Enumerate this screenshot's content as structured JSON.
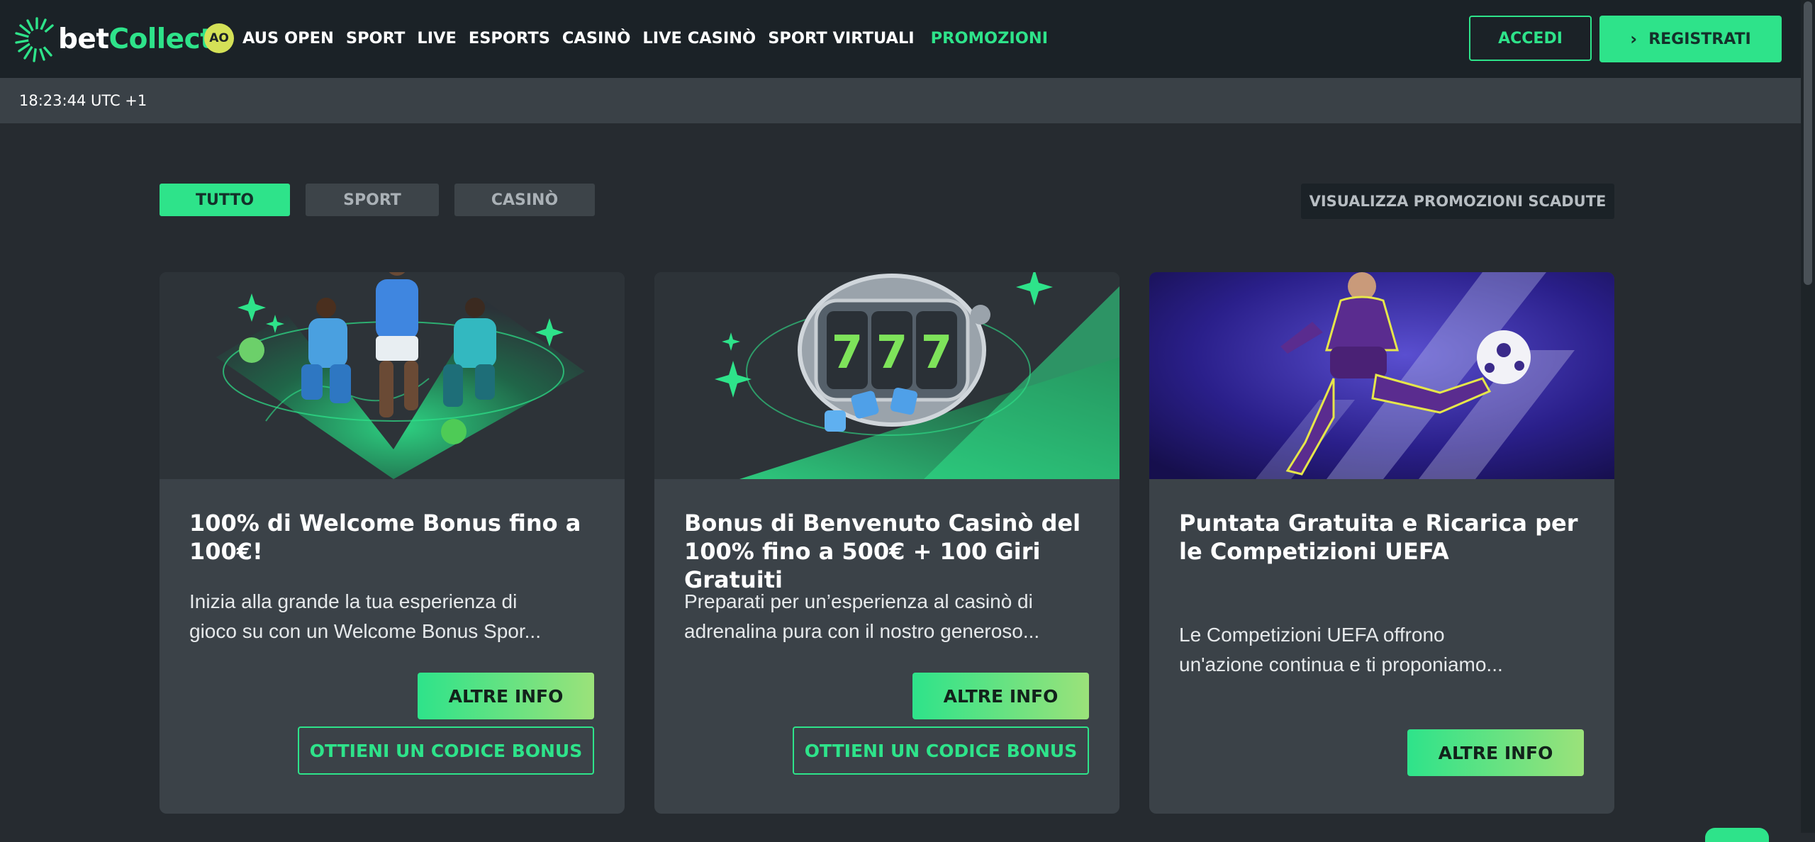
{
  "header": {
    "logo": {
      "bet": "bet",
      "collect": "Collect"
    },
    "ao_badge": "AO",
    "nav": [
      "AUS OPEN",
      "SPORT",
      "LIVE",
      "ESPORTS",
      "CASINÒ",
      "LIVE CASINÒ",
      "SPORT VIRTUALI",
      "PROMOZIONI"
    ],
    "login_label": "ACCEDI",
    "register_label": "REGISTRATI",
    "accent": "#2ee38a"
  },
  "timebar": {
    "time": "18:23:44 UTC +1"
  },
  "filters": {
    "tabs": [
      "TUTTO",
      "SPORT",
      "CASINÒ"
    ],
    "active": "TUTTO",
    "expired_label": "VISUALIZZA PROMOZIONI SCADUTE"
  },
  "promotions": [
    {
      "title": "100% di Welcome Bonus fino a 100€!",
      "description_line1": "Inizia alla grande la tua esperienza di",
      "description_line2": "gioco su con un Welcome Bonus Spor...",
      "info_label": "ALTRE INFO",
      "code_label": "OTTIENI UN CODICE BONUS",
      "image": "football-players-green-illustration"
    },
    {
      "title": "Bonus di Benvenuto Casinò del 100% fino a 500€ + 100 Giri Gratuiti",
      "description_line1": "Preparati per un’esperienza al casinò di",
      "description_line2": "adrenalina pura con il nostro generoso...",
      "info_label": "ALTRE INFO",
      "code_label": "OTTIENI UN CODICE BONUS",
      "image": "slot-machine-777-dice"
    },
    {
      "title": "Puntata Gratuita e Ricarica per le Competizioni UEFA",
      "description_line1": "Le Competizioni UEFA offrono",
      "description_line2": "un'azione continua e ti proponiamo...",
      "info_label": "ALTRE INFO",
      "image": "footballer-purple-kit-volley"
    }
  ]
}
